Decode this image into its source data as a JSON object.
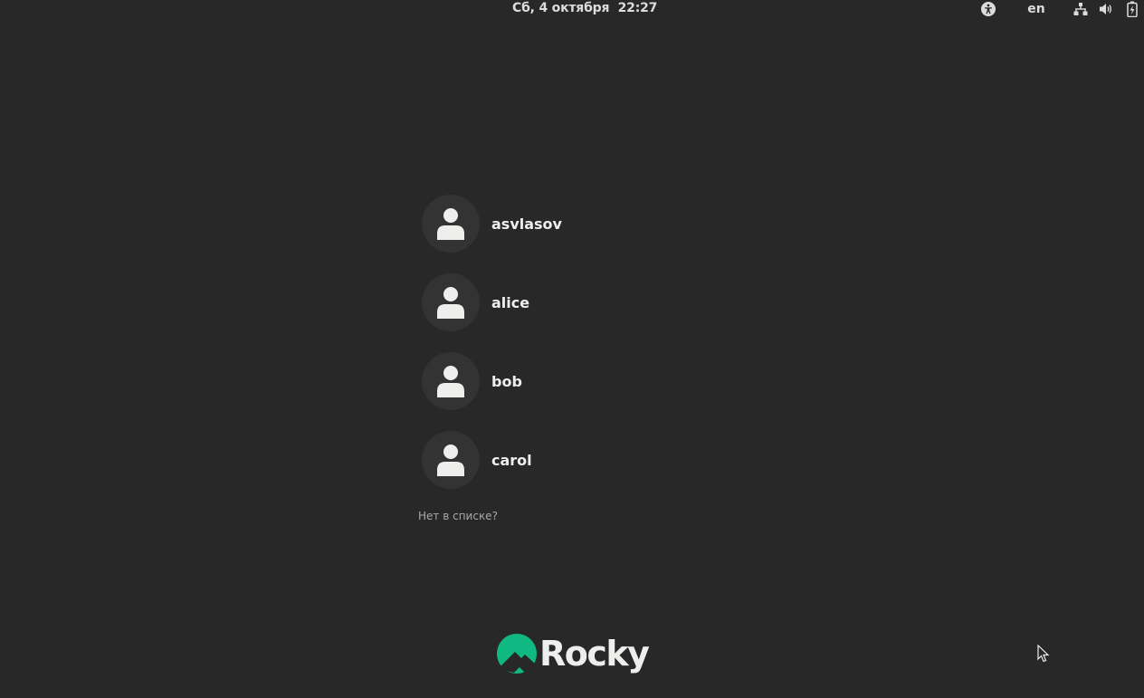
{
  "topbar": {
    "clock": "Сб, 4 октября  22:27",
    "lang": "en",
    "icons": [
      "accessibility-icon",
      "network-icon",
      "volume-icon",
      "battery-icon"
    ]
  },
  "users": [
    {
      "name": "asvlasov"
    },
    {
      "name": "alice"
    },
    {
      "name": "bob"
    },
    {
      "name": "carol"
    }
  ],
  "not_listed": "Нет в списке?",
  "logo": {
    "text": "Rocky",
    "brand_color": "#10b981"
  },
  "colors": {
    "background": "#282828",
    "avatar_bg": "#333333",
    "text": "#eeeeec"
  }
}
